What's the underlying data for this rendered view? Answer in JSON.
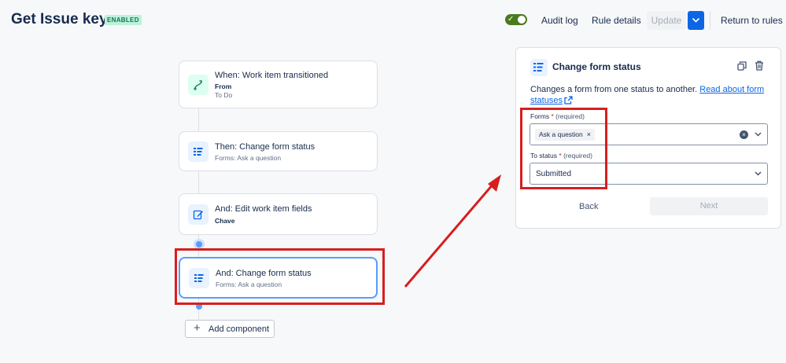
{
  "header": {
    "title": "Get Issue key",
    "status_badge": "ENABLED",
    "toggle_on": true,
    "links": {
      "audit_log": "Audit log",
      "rule_details": "Rule details",
      "update": "Update",
      "return_to_rules": "Return to rules"
    }
  },
  "flow": {
    "cards": [
      {
        "title": "When: Work item transitioned",
        "line2": "From",
        "line3": "To Do",
        "icon": "transition-icon"
      },
      {
        "title": "Then: Change form status",
        "line2": "Forms: Ask a question",
        "icon": "form-icon"
      },
      {
        "title": "And: Edit work item fields",
        "line2": "Chave",
        "icon": "edit-icon"
      },
      {
        "title": "And: Change form status",
        "line2": "Forms: Ask a question",
        "icon": "form-icon",
        "selected": true
      }
    ],
    "add_component": "Add component"
  },
  "panel": {
    "title": "Change form status",
    "description": "Changes a form from one status to another.",
    "link_text": "Read about form statuses",
    "forms_label": "Forms",
    "forms_required": "(required)",
    "forms_chip": "Ask a question",
    "to_status_label": "To status",
    "to_status_required": "(required)",
    "to_status_value": "Submitted",
    "back_label": "Back",
    "next_label": "Next"
  },
  "colors": {
    "accent": "#0c66e4",
    "annotation": "#d81e1e",
    "enabled_badge_bg": "#baf3db"
  }
}
